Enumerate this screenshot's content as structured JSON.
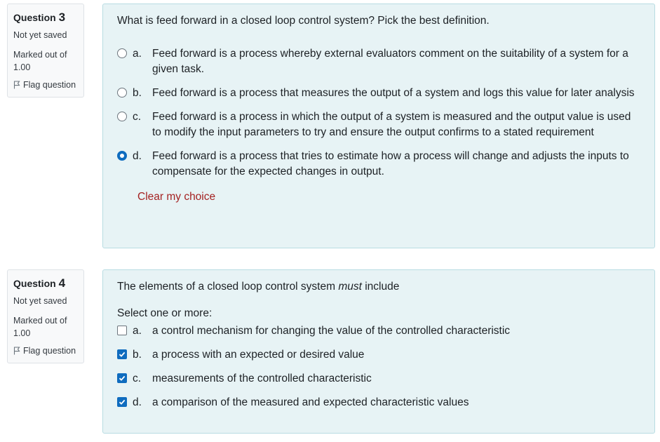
{
  "q3": {
    "question_word": "Question",
    "number": "3",
    "state": "Not yet saved",
    "grade_line1": "Marked out of",
    "grade_line2": "1.00",
    "flag_label": "Flag question",
    "text": "What is feed forward in a closed loop control system? Pick the best definition.",
    "options": [
      {
        "letter": "a.",
        "text": "Feed forward is a process whereby external evaluators comment on the suitability of a system for a given task.",
        "checked": false
      },
      {
        "letter": "b.",
        "text": "Feed forward is a process that measures the output of a system and logs this value for later analysis",
        "checked": false
      },
      {
        "letter": "c.",
        "text": "Feed forward is a process in which the output of a system is measured and the output value is used to modify the input parameters to try and ensure the output confirms to a stated requirement",
        "checked": false
      },
      {
        "letter": "d.",
        "text": "Feed forward is a process that tries to estimate how a process will change and adjusts the inputs to compensate for the expected changes in output.",
        "checked": true
      }
    ],
    "clear_label": "Clear my choice"
  },
  "q4": {
    "question_word": "Question",
    "number": "4",
    "state": "Not yet saved",
    "grade_line1": "Marked out of",
    "grade_line2": "1.00",
    "flag_label": "Flag question",
    "text_before": "The elements of a closed loop control system ",
    "text_emphasis": "must",
    "text_after": " include",
    "prompt": "Select one or more:",
    "options": [
      {
        "letter": "a.",
        "text": "a control mechanism for changing the value of the controlled characteristic",
        "checked": false
      },
      {
        "letter": "b.",
        "text": "a process with an expected or desired value",
        "checked": true
      },
      {
        "letter": "c.",
        "text": "measurements of the controlled characteristic",
        "checked": true
      },
      {
        "letter": "d.",
        "text": "a comparison of the measured and expected characteristic values",
        "checked": true
      }
    ]
  },
  "colors": {
    "accent": "#0f6cbf",
    "clear_link": "#a42222",
    "content_bg": "#e7f3f5"
  },
  "icons": {
    "flag": "flag-icon",
    "radio": "radio-button",
    "checkbox": "checkbox"
  }
}
